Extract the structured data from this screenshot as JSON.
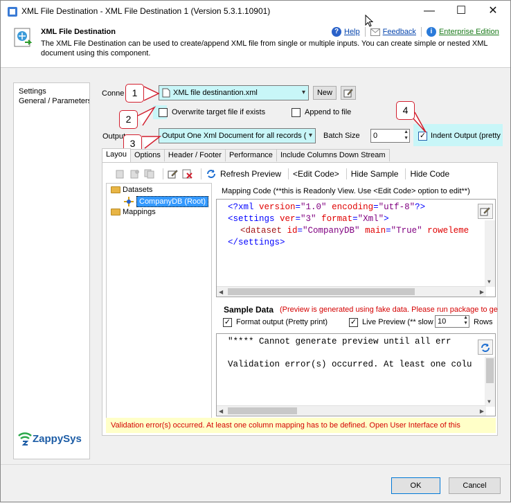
{
  "window": {
    "title": "XML File Destination - XML File Destination 1 (Version 5.3.1.10901)",
    "controls": {
      "minimize": "—",
      "maximize": "☐",
      "close": "✕"
    }
  },
  "header": {
    "title": "XML File Destination",
    "description": "The XML File Destination can be used to create/append XML file from single or multiple inputs. You can create simple or nested XML document using this component.",
    "help": "Help",
    "feedback": "Feedback",
    "edition": "Enterprise Edition"
  },
  "leftnav": {
    "items": [
      "Settings",
      "General / Parameters"
    ]
  },
  "form": {
    "connection_label": "Conne",
    "connection_value": "XML file destinantion.xml",
    "new_button": "New",
    "overwrite_label": "Overwrite target file if exists",
    "overwrite_checked": false,
    "append_label": "Append to file",
    "append_checked": false,
    "output_label": "Output",
    "output_value": "Output One Xml Document for all records (",
    "batch_label": "Batch Size",
    "batch_value": "0",
    "indent_label": "Indent Output (pretty",
    "indent_checked": true
  },
  "callouts": [
    "1",
    "2",
    "3",
    "4"
  ],
  "tabs": [
    "Layout",
    "Options",
    "Header / Footer",
    "Performance",
    "Include Columns Down Stream"
  ],
  "tab_display": [
    "Layou",
    "Options",
    "Header / Footer",
    "Performance",
    "Include Columns Down Stream"
  ],
  "toolbar": {
    "refresh": "Refresh Preview",
    "edit_code": "<Edit Code>",
    "hide_sample": "Hide Sample",
    "hide_code": "Hide Code"
  },
  "tree": {
    "datasets": "Datasets",
    "companydb": "CompanyDB (Root)",
    "mappings": "Mappings"
  },
  "mapping": {
    "label": "Mapping Code (**this is Readonly View. Use <Edit Code> option to edit**)",
    "line1": {
      "a": "<?xml ",
      "b": "version",
      "c": "=",
      "d": "\"1.0\"",
      "e": " encoding",
      "f": "=",
      "g": "\"utf-8\"",
      "h": "?>"
    },
    "line2": {
      "a": "<settings ",
      "b": "ver",
      "c": "=",
      "d": "\"3\"",
      "e": " format",
      "f": "=",
      "g": "\"Xml\"",
      "h": ">"
    },
    "line3": {
      "a": "<dataset ",
      "b": "id",
      "c": "=",
      "d": "\"CompanyDB\"",
      "e": " main",
      "f": "=",
      "g": "\"True\"",
      "h": " roweleme"
    },
    "line4": "</settings>"
  },
  "sample": {
    "title": "Sample Data",
    "note": "(Preview is generated using fake data. Please run package to ge",
    "format_label": "Format output (Pretty print)",
    "format_checked": true,
    "live_label": "Live Preview (** slow",
    "live_checked": true,
    "rows_value": "10",
    "rows_label": "Rows",
    "output_line1": "\"**** Cannot generate preview until all err",
    "output_line2": "Validation error(s) occurred. At least one colu"
  },
  "error_message": "Validation error(s) occurred. At least one column mapping has to be defined. Open User Interface of this",
  "brand": {
    "logo_text": "ZappySys",
    "accent": "#1d5da6"
  },
  "buttons": {
    "ok": "OK",
    "cancel": "Cancel"
  },
  "colors": {
    "callout_red": "#d21f2e",
    "highlight_cyan": "#c8f6f8",
    "error_text": "#d40000"
  }
}
